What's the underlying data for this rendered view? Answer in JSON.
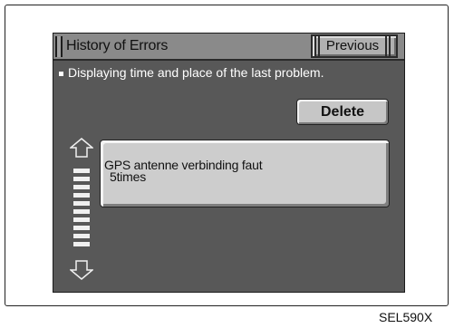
{
  "header": {
    "title": "History of Errors",
    "previous_label": "Previous"
  },
  "info": {
    "text": "Displaying time and place of the last problem."
  },
  "actions": {
    "delete_label": "Delete"
  },
  "error_list": {
    "items": [
      {
        "message": "GPS antenne verbinding faut",
        "count": "5times"
      }
    ]
  },
  "scroll": {
    "up_icon": "arrow-up-icon",
    "down_icon": "arrow-down-icon",
    "segments": 10
  },
  "figure": {
    "code": "SEL590X"
  },
  "colors": {
    "screen_bg": "#585858",
    "title_bar": "#8a8a8a",
    "button_face": "#c6c6c6",
    "text_on_screen": "#ffffff"
  }
}
